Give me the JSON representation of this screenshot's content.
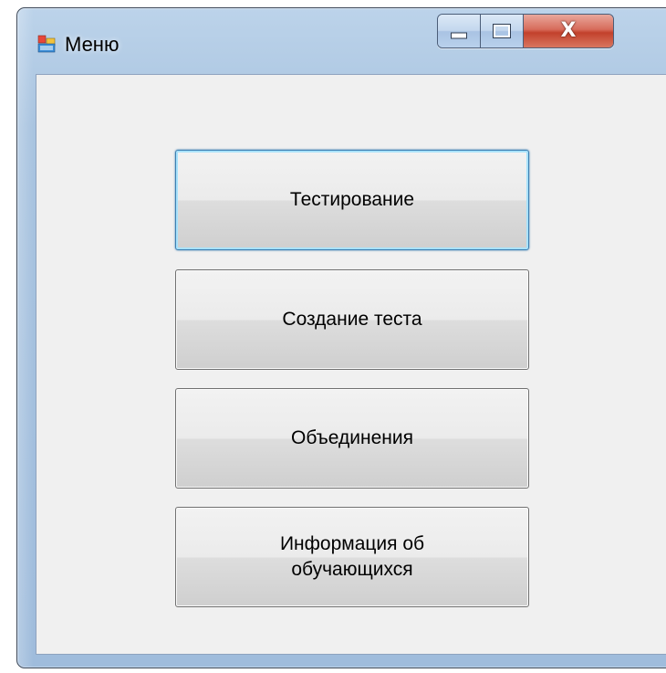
{
  "window": {
    "title": "Меню",
    "icon": "app-window-icon",
    "controls": {
      "minimize_icon": "minimize-icon",
      "maximize_icon": "maximize-icon",
      "close_label": "X"
    }
  },
  "menu": {
    "buttons": [
      {
        "label": "Тестирование",
        "focused": true
      },
      {
        "label": "Создание теста",
        "focused": false
      },
      {
        "label": "Объединения",
        "focused": false
      },
      {
        "label": "Информация об\nобучающихся",
        "focused": false
      }
    ]
  },
  "colors": {
    "focus_border": "#3c7fb1",
    "focus_glow": "#a9e2fb",
    "close_button": "#c2412c",
    "client_bg": "#f0f0f0"
  }
}
